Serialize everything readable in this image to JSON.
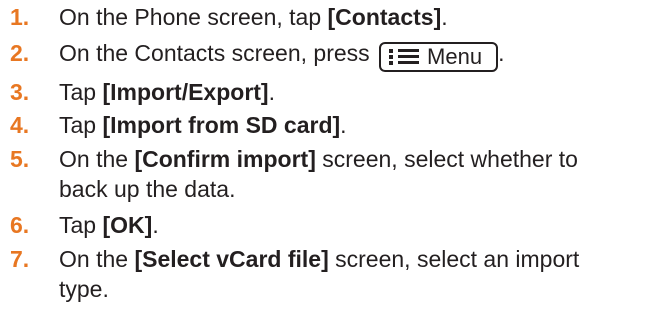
{
  "steps": [
    {
      "number": "1.",
      "parts": {
        "a": "On the Phone screen, tap ",
        "b": "[Contacts]",
        "c": "."
      }
    },
    {
      "number": "2.",
      "parts": {
        "a": "On the Contacts screen, press ",
        "key": "Menu",
        "c": "."
      }
    },
    {
      "number": "3.",
      "parts": {
        "a": "Tap ",
        "b": "[Import/Export]",
        "c": "."
      }
    },
    {
      "number": "4.",
      "parts": {
        "a": "Tap ",
        "b": "[Import from SD card]",
        "c": "."
      }
    },
    {
      "number": "5.",
      "parts": {
        "a": "On the ",
        "b": "[Confirm import]",
        "c": " screen, select whether to",
        "d": "back up the data."
      }
    },
    {
      "number": "6.",
      "parts": {
        "a": "Tap ",
        "b": "[OK]",
        "c": "."
      }
    },
    {
      "number": "7.",
      "parts": {
        "a": "On the ",
        "b": "[Select vCard file]",
        "c": " screen, select an import",
        "d": "type."
      }
    }
  ],
  "icons": {
    "menu_key_icon": "menu-list-icon"
  },
  "colors": {
    "step_number": "#e87722",
    "text": "#231f20"
  }
}
